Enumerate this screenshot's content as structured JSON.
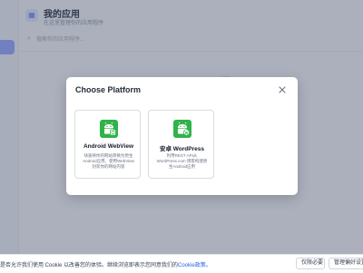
{
  "app": {
    "title": "我的应用",
    "subtitle": "在这里管理你的应用程序",
    "search_placeholder": "搜索你的应用程序..."
  },
  "modal": {
    "title": "Choose Platform",
    "close_icon": "close-icon",
    "options": [
      {
        "title": "Android WebView",
        "description": "快速将你的网站转换为原生Android应用，使用WebView封装你的网站内容",
        "icon": "android-webview-icon",
        "color": "#2fb34a"
      },
      {
        "title": "安卓 WordPress",
        "description": "利用REST API从WordPress.com 博客构建原生Android应用",
        "icon": "android-wordpress-icon",
        "color": "#2fb34a"
      }
    ]
  },
  "cookie": {
    "text": "是否允许我们使用 Cookie 以改善您的体验。继续浏览即表示您同意我们的",
    "link": "Cookie政策。",
    "reject_label": "仅限必要",
    "manage_label": "管理偏好设置"
  },
  "colors": {
    "accent": "#5b6ef5",
    "android_green": "#2fb34a",
    "link": "#2563eb"
  }
}
